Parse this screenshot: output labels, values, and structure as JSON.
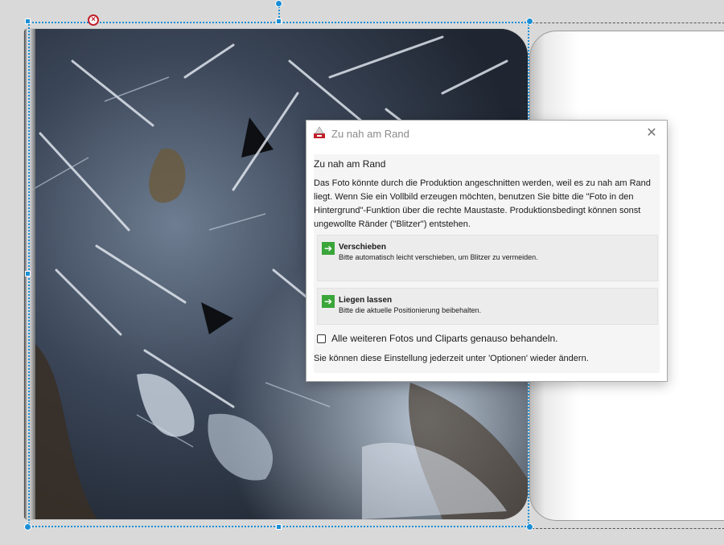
{
  "dialog": {
    "title": "Zu nah am Rand",
    "heading": "Zu nah am Rand",
    "message": "Das Foto könnte durch die Produktion angeschnitten werden, weil es zu nah am Rand liegt. Wenn Sie ein Vollbild erzeugen möchten, benutzen Sie bitte die \"Foto in den Hintergrund\"-Funktion über die rechte Maustaste. Produktionsbedingt können sonst ungewollte Ränder  (\"Blitzer\") entstehen.",
    "options": [
      {
        "title": "Verschieben",
        "description": "Bitte automatisch leicht verschieben, um Blitzer zu vermeiden.",
        "icon": "green-arrow-icon"
      },
      {
        "title": "Liegen lassen",
        "description": "Bitte die aktuelle Positionierung beibehalten.",
        "icon": "green-arrow-icon"
      }
    ],
    "checkbox_label": "Alle weiteren Fotos und Cliparts genauso behandeln.",
    "checkbox_checked": false,
    "footer_note": "Sie können diese Einstellung jederzeit unter 'Optionen' wieder ändern.",
    "close_icon": "close-icon"
  },
  "colors": {
    "selection": "#1a8fd6",
    "delete_handle": "#c0202a",
    "option_arrow": "#3aa63a"
  }
}
